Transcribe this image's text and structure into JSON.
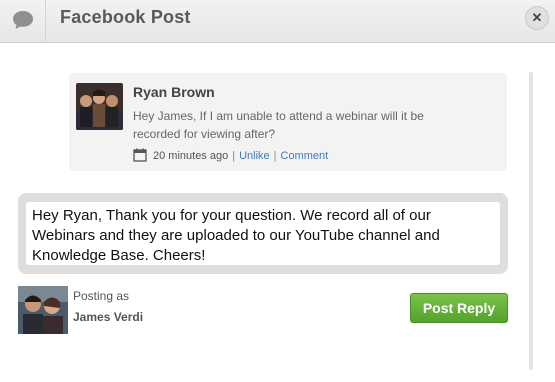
{
  "window": {
    "title": "Facebook Post",
    "close_glyph": "✕",
    "title_icon": "speech-bubble-icon",
    "close_icon": "close-icon"
  },
  "comment": {
    "author": "Ryan Brown",
    "text": "Hey James, If I am unable to attend a webinar will it be recorded for viewing after?",
    "time": "20 minutes ago",
    "separator": "|",
    "unlike_label": "Unlike",
    "comment_label": "Comment",
    "time_icon": "calendar-icon"
  },
  "reply": {
    "text": "Hey Ryan, Thank you for your question. We record all of our Webinars and they are uploaded to our YouTube channel and Knowledge Base. Cheers!"
  },
  "poster": {
    "posting_as_label": "Posting as",
    "name": "James Verdi"
  },
  "actions": {
    "post_reply_label": "Post Reply"
  },
  "colors": {
    "accent_green": "#52a32c",
    "link_blue": "#3b7bbf",
    "title_gray": "#5a5a5a"
  }
}
